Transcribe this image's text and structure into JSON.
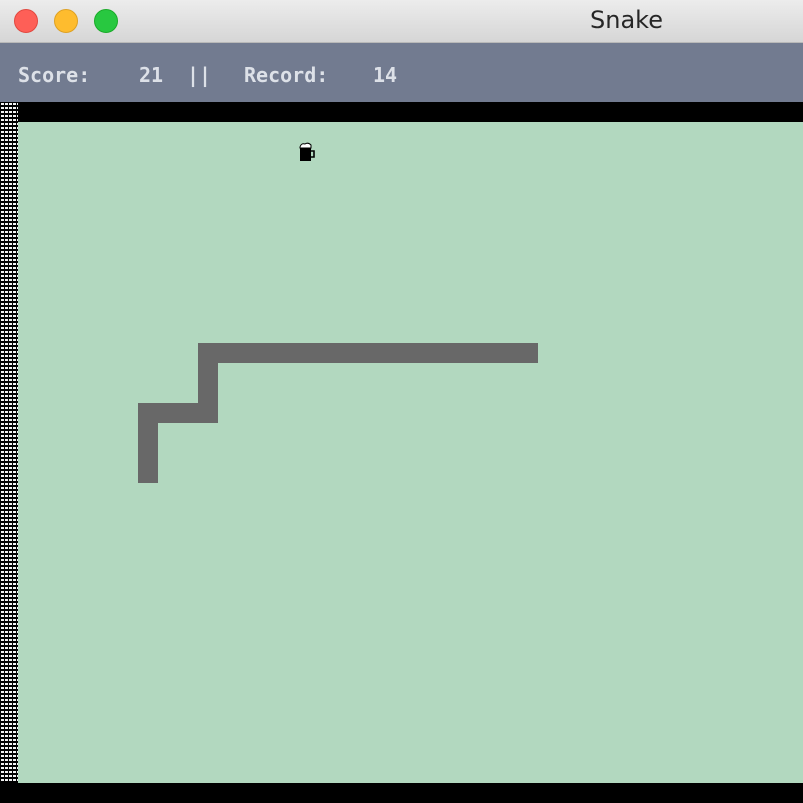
{
  "window": {
    "title": "Snake"
  },
  "scoreboard": {
    "score_label": "Score:",
    "score_value": "21",
    "separator": "||",
    "record_label": "Record:",
    "record_value": "14"
  },
  "game": {
    "food_icon": "beer-mug-icon",
    "colors": {
      "field": "#b2d8bf",
      "snake": "#686868",
      "header": "#727b90"
    }
  }
}
